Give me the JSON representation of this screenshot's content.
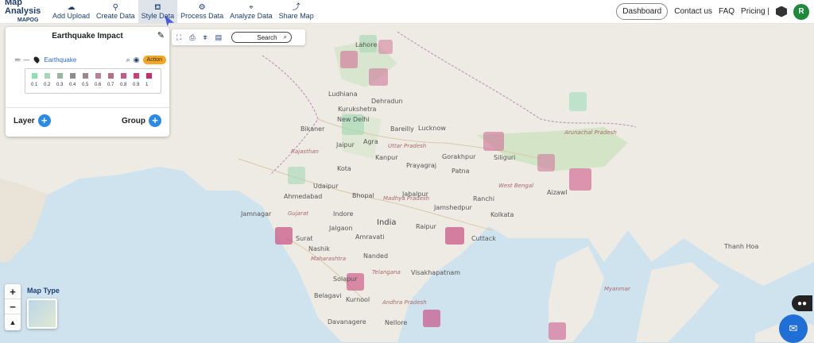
{
  "app": {
    "title_line1": "Map Analysis",
    "title_line2": "MAPOG"
  },
  "nav": [
    {
      "label": "Add Upload",
      "icon": "cloud-upload-icon",
      "glyph": "☁"
    },
    {
      "label": "Create Data",
      "icon": "map-pin-icon",
      "glyph": "⚲"
    },
    {
      "label": "Style Data",
      "icon": "paint-bucket-icon",
      "glyph": "⛾",
      "active": true
    },
    {
      "label": "Process Data",
      "icon": "process-icon",
      "glyph": "⚙"
    },
    {
      "label": "Analyze Data",
      "icon": "analyze-icon",
      "glyph": "⌖"
    },
    {
      "label": "Share Map",
      "icon": "share-icon",
      "glyph": "⤴"
    }
  ],
  "header_right": {
    "dashboard": "Dashboard",
    "contact": "Contact us",
    "faq": "FAQ",
    "pricing": "Pricing |",
    "avatar_initial": "R"
  },
  "panel": {
    "title": "Earthquake Impact",
    "layer_name": "Earthquake",
    "action_label": "Action",
    "legend": [
      {
        "label": "0.1",
        "color": "#8fe0b0"
      },
      {
        "label": "0.2",
        "color": "#a8d7b7"
      },
      {
        "label": "0.3",
        "color": "#96b89e"
      },
      {
        "label": "0.4",
        "color": "#8a8e8a"
      },
      {
        "label": "0.5",
        "color": "#9a8792"
      },
      {
        "label": "0.6",
        "color": "#b7839a"
      },
      {
        "label": "0.7",
        "color": "#b56d8a"
      },
      {
        "label": "0.8",
        "color": "#c25a86"
      },
      {
        "label": "0.9",
        "color": "#cc3f7c"
      },
      {
        "label": "1",
        "color": "#c22e6f"
      }
    ],
    "layer_button": "Layer",
    "group_button": "Group"
  },
  "map_toolbar": {
    "search_label": "Search"
  },
  "map_type_label": "Map Type",
  "map_labels": [
    {
      "text": "Lahore",
      "cls": ""
    },
    {
      "text": "Ludhiana",
      "cls": ""
    },
    {
      "text": "Kurukshetra",
      "cls": ""
    },
    {
      "text": "Dehradun",
      "cls": ""
    },
    {
      "text": "New Delhi",
      "cls": ""
    },
    {
      "text": "Bikaner",
      "cls": ""
    },
    {
      "text": "Jaipur",
      "cls": ""
    },
    {
      "text": "Agra",
      "cls": ""
    },
    {
      "text": "Bareilly",
      "cls": ""
    },
    {
      "text": "Lucknow",
      "cls": ""
    },
    {
      "text": "Kanpur",
      "cls": ""
    },
    {
      "text": "Uttar Pradesh",
      "cls": "region"
    },
    {
      "text": "Rajasthan",
      "cls": "region"
    },
    {
      "text": "Gorakhpur",
      "cls": ""
    },
    {
      "text": "Prayagraj",
      "cls": ""
    },
    {
      "text": "Patna",
      "cls": ""
    },
    {
      "text": "Kota",
      "cls": ""
    },
    {
      "text": "Udaipur",
      "cls": ""
    },
    {
      "text": "Ahmedabad",
      "cls": ""
    },
    {
      "text": "Bhopal",
      "cls": ""
    },
    {
      "text": "Jabalpur",
      "cls": ""
    },
    {
      "text": "Ranchi",
      "cls": ""
    },
    {
      "text": "Jamshedpur",
      "cls": ""
    },
    {
      "text": "Kolkata",
      "cls": ""
    },
    {
      "text": "Indore",
      "cls": ""
    },
    {
      "text": "India",
      "cls": "big"
    },
    {
      "text": "Jamnagar",
      "cls": ""
    },
    {
      "text": "Gujarat",
      "cls": "region"
    },
    {
      "text": "Surat",
      "cls": ""
    },
    {
      "text": "Jalgaon",
      "cls": ""
    },
    {
      "text": "Amravati",
      "cls": ""
    },
    {
      "text": "Raipur",
      "cls": ""
    },
    {
      "text": "Cuttack",
      "cls": ""
    },
    {
      "text": "Nashik",
      "cls": ""
    },
    {
      "text": "Maharashtra",
      "cls": "region"
    },
    {
      "text": "Nanded",
      "cls": ""
    },
    {
      "text": "Telangana",
      "cls": "region"
    },
    {
      "text": "Visakhapatnam",
      "cls": ""
    },
    {
      "text": "Solapur",
      "cls": ""
    },
    {
      "text": "Belagavi",
      "cls": ""
    },
    {
      "text": "Kurnool",
      "cls": ""
    },
    {
      "text": "Andhra Pradesh",
      "cls": "region"
    },
    {
      "text": "Davanagere",
      "cls": ""
    },
    {
      "text": "Nellore",
      "cls": ""
    },
    {
      "text": "Siliguri",
      "cls": ""
    },
    {
      "text": "Aizawl",
      "cls": ""
    },
    {
      "text": "Arunachal Pradesh",
      "cls": "region"
    },
    {
      "text": "West Bengal",
      "cls": "region"
    },
    {
      "text": "Madhya Pradesh",
      "cls": "region"
    },
    {
      "text": "Thanh Hoa",
      "cls": ""
    },
    {
      "text": "Myanmar",
      "cls": "region"
    }
  ]
}
